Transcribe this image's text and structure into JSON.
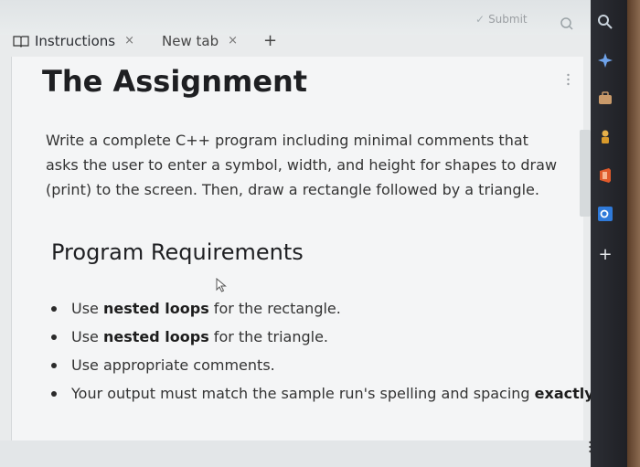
{
  "toolbar": {
    "submit_label": "Submit"
  },
  "tabs": [
    {
      "label": "Instructions",
      "close": "×"
    },
    {
      "label": "New tab",
      "close": "×"
    }
  ],
  "tab_add": "+",
  "content": {
    "title": "The Assignment",
    "intro": "Write a complete C++ program including minimal comments that asks the user to enter a symbol, width, and height for shapes to draw (print) to the screen. Then, draw a rectangle followed by a triangle.",
    "requirements_heading": "Program Requirements",
    "requirements": [
      {
        "before": "Use ",
        "bold": "nested loops",
        "after": " for the rectangle."
      },
      {
        "before": "Use ",
        "bold": "nested loops",
        "after": " for the triangle."
      },
      {
        "before": "Use appropriate comments.",
        "bold": "",
        "after": ""
      },
      {
        "before": "Your output must match the sample run's spelling and spacing ",
        "bold": "exactly",
        "after": "."
      }
    ]
  },
  "sidebar": {
    "icons": [
      "search-icon",
      "sparkle-icon",
      "briefcase-icon",
      "chess-piece-icon",
      "office-icon",
      "outlook-icon",
      "plus-icon"
    ],
    "plus_label": "+"
  },
  "colors": {
    "page_bg": "#f4f5f6",
    "rail_bg": "#1f2126",
    "accent_blue": "#2f7ad9"
  }
}
